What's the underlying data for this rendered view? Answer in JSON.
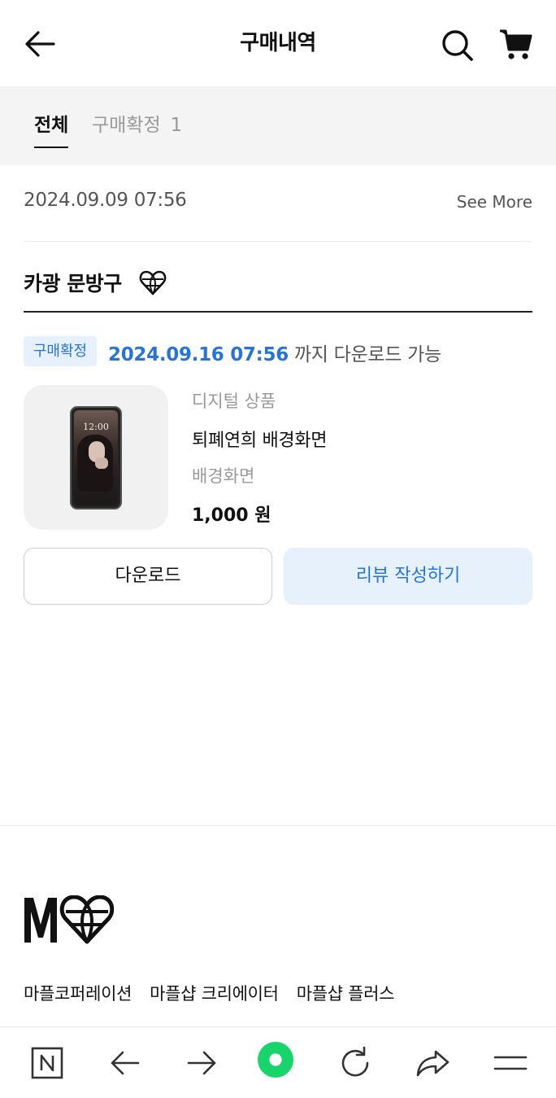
{
  "header": {
    "title": "구매내역",
    "back_icon": "arrow-left-icon",
    "search_icon": "search-icon",
    "cart_icon": "cart-icon"
  },
  "tabs": {
    "all": "전체",
    "confirmed_label": "구매확정",
    "confirmed_count": "1"
  },
  "order": {
    "date": "2024.09.09 07:56",
    "see_more": "See More",
    "shop_name": "카광 문방구",
    "status_badge": "구매확정",
    "download_until_date": "2024.09.16 07:56",
    "download_until_suffix": " 까지 다운로드 가능",
    "product": {
      "type": "디지털 상품",
      "name": "퇴폐연희 배경화면",
      "option": "배경화면",
      "price": "1,000 원",
      "thumbnail_time": "12:00"
    },
    "download_button": "다운로드",
    "review_button": "리뷰 작성하기"
  },
  "footer": {
    "links": [
      "마플코퍼레이션",
      "마플샵 크리에이터",
      "마플샵 플러스"
    ]
  },
  "colors": {
    "accent_blue": "#2774d6",
    "badge_bg": "#e6f1fd",
    "review_bg": "#e7f1fb",
    "tab_bg": "#f4f4f4",
    "home_green": "#19d46a"
  },
  "bottom_bar": {
    "icons": [
      "n-box-icon",
      "arrow-left-icon",
      "arrow-right-icon",
      "home-circle-icon",
      "refresh-icon",
      "share-icon",
      "menu-icon"
    ]
  }
}
